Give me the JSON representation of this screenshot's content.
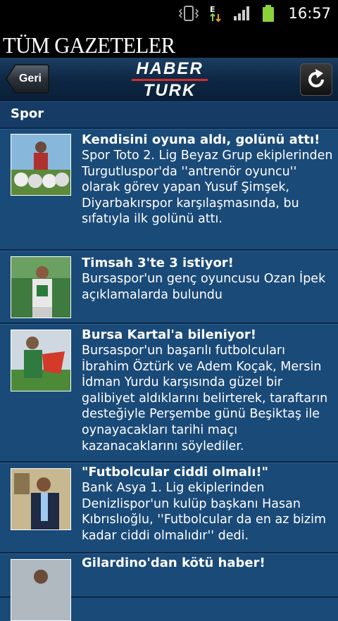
{
  "status_bar": {
    "time": "16:57"
  },
  "app": {
    "title": "TÜM GAZETELER"
  },
  "header": {
    "back_label": "Geri",
    "logo_line1": "HABER",
    "logo_line2": "TURK"
  },
  "section": {
    "label": "Spor"
  },
  "articles": [
    {
      "title": "Kendisini oyuna aldı, golünü attı!",
      "description": "Spor Toto 2. Lig Beyaz Grup ekiplerinden Turgutluspor'da ''antrenör oyuncu'' olarak görev yapan Yusuf Şimşek, Diyarbakırspor karşılaşmasında, bu sıfatıyla ilk golünü attı."
    },
    {
      "title": "Timsah 3'te 3 istiyor!",
      "description": "Bursaspor'un genç oyuncusu Ozan İpek açıklamalarda bulundu"
    },
    {
      "title": "Bursa Kartal'a bileniyor!",
      "description": "Bursaspor'un başarılı futbolcuları İbrahim Öztürk ve Adem Koçak, Mersin İdman Yurdu karşısında güzel bir galibiyet aldıklarını belirterek, taraftarın desteğiyle Perşembe günü Beşiktaş ile oynayacakları tarihi maçı kazanacaklarını söylediler."
    },
    {
      "title": "\"Futbolcular ciddi olmalı!\"",
      "description": "Bank Asya 1. Lig ekiplerinden Denizlispor'un kulüp başkanı Hasan Kıbrıslıoğlu, ''Futbolcular da en az bizim kadar ciddi olmalıdır'' dedi."
    },
    {
      "title": "Gilardino'dan kötü haber!",
      "description": ""
    }
  ]
}
